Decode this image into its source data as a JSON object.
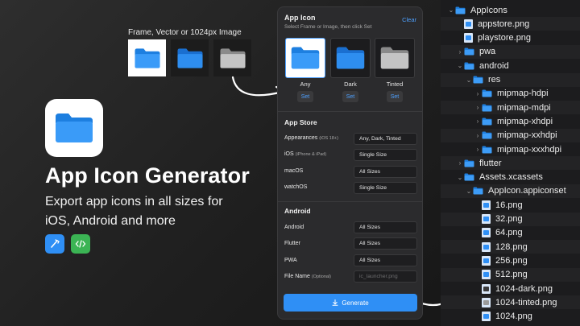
{
  "hero": {
    "title": "App Icon Generator",
    "subtitle": "Export app icons in all sizes for iOS, Android and more",
    "badges": [
      "xcode-icon",
      "code-icon"
    ]
  },
  "frames": {
    "label": "Frame, Vector or 1024px Image"
  },
  "panel": {
    "title": "App Icon",
    "subtitle": "Select Frame or Image, then click Set",
    "clear_label": "Clear",
    "slots": [
      {
        "label": "Any",
        "set_label": "Set"
      },
      {
        "label": "Dark",
        "set_label": "Set"
      },
      {
        "label": "Tinted",
        "set_label": "Set"
      }
    ],
    "app_store": {
      "title": "App Store",
      "rows": [
        {
          "label": "Appearances",
          "note": "(iOS 18+)",
          "value": "Any, Dark, Tinted"
        },
        {
          "label": "iOS",
          "note": "(iPhone & iPad)",
          "value": "Single Size"
        },
        {
          "label": "macOS",
          "note": "",
          "value": "All Sizes"
        },
        {
          "label": "watchOS",
          "note": "",
          "value": "Single Size"
        }
      ]
    },
    "android": {
      "title": "Android",
      "rows": [
        {
          "label": "Android",
          "note": "",
          "value": "All Sizes"
        },
        {
          "label": "Flutter",
          "note": "",
          "value": "All Sizes"
        },
        {
          "label": "PWA",
          "note": "",
          "value": "All Sizes"
        }
      ],
      "file_name": {
        "label": "File Name",
        "note": "(Optional)",
        "placeholder": "ic_launcher.png"
      }
    },
    "generate_label": "Generate"
  },
  "tree": [
    {
      "name": "AppIcons",
      "type": "folder",
      "depth": 0,
      "chevron": "down"
    },
    {
      "name": "appstore.png",
      "type": "file",
      "depth": 1
    },
    {
      "name": "playstore.png",
      "type": "file",
      "depth": 1
    },
    {
      "name": "pwa",
      "type": "folder",
      "depth": 1,
      "chevron": "right"
    },
    {
      "name": "android",
      "type": "folder",
      "depth": 1,
      "chevron": "down"
    },
    {
      "name": "res",
      "type": "folder",
      "depth": 2,
      "chevron": "down"
    },
    {
      "name": "mipmap-hdpi",
      "type": "folder",
      "depth": 3,
      "chevron": "right"
    },
    {
      "name": "mipmap-mdpi",
      "type": "folder",
      "depth": 3,
      "chevron": "right"
    },
    {
      "name": "mipmap-xhdpi",
      "type": "folder",
      "depth": 3,
      "chevron": "right"
    },
    {
      "name": "mipmap-xxhdpi",
      "type": "folder",
      "depth": 3,
      "chevron": "right"
    },
    {
      "name": "mipmap-xxxhdpi",
      "type": "folder",
      "depth": 3,
      "chevron": "right"
    },
    {
      "name": "flutter",
      "type": "folder",
      "depth": 1,
      "chevron": "right"
    },
    {
      "name": "Assets.xcassets",
      "type": "folder",
      "depth": 1,
      "chevron": "down"
    },
    {
      "name": "AppIcon.appiconset",
      "type": "folder",
      "depth": 2,
      "chevron": "down"
    },
    {
      "name": "16.png",
      "type": "file",
      "depth": 3
    },
    {
      "name": "32.png",
      "type": "file",
      "depth": 3
    },
    {
      "name": "64.png",
      "type": "file",
      "depth": 3
    },
    {
      "name": "128.png",
      "type": "file",
      "depth": 3
    },
    {
      "name": "256.png",
      "type": "file",
      "depth": 3
    },
    {
      "name": "512.png",
      "type": "file",
      "depth": 3
    },
    {
      "name": "1024-dark.png",
      "type": "file",
      "depth": 3,
      "variant": "dark"
    },
    {
      "name": "1024-tinted.png",
      "type": "file",
      "depth": 3,
      "variant": "tinted"
    },
    {
      "name": "1024.png",
      "type": "file",
      "depth": 3
    }
  ],
  "colors": {
    "accent": "#2f8ff5",
    "link": "#4ea1ff",
    "folder_blue": "#2f8ff5",
    "panel_bg": "#2b2b2d",
    "tree_bg": "#1c1c1e"
  }
}
